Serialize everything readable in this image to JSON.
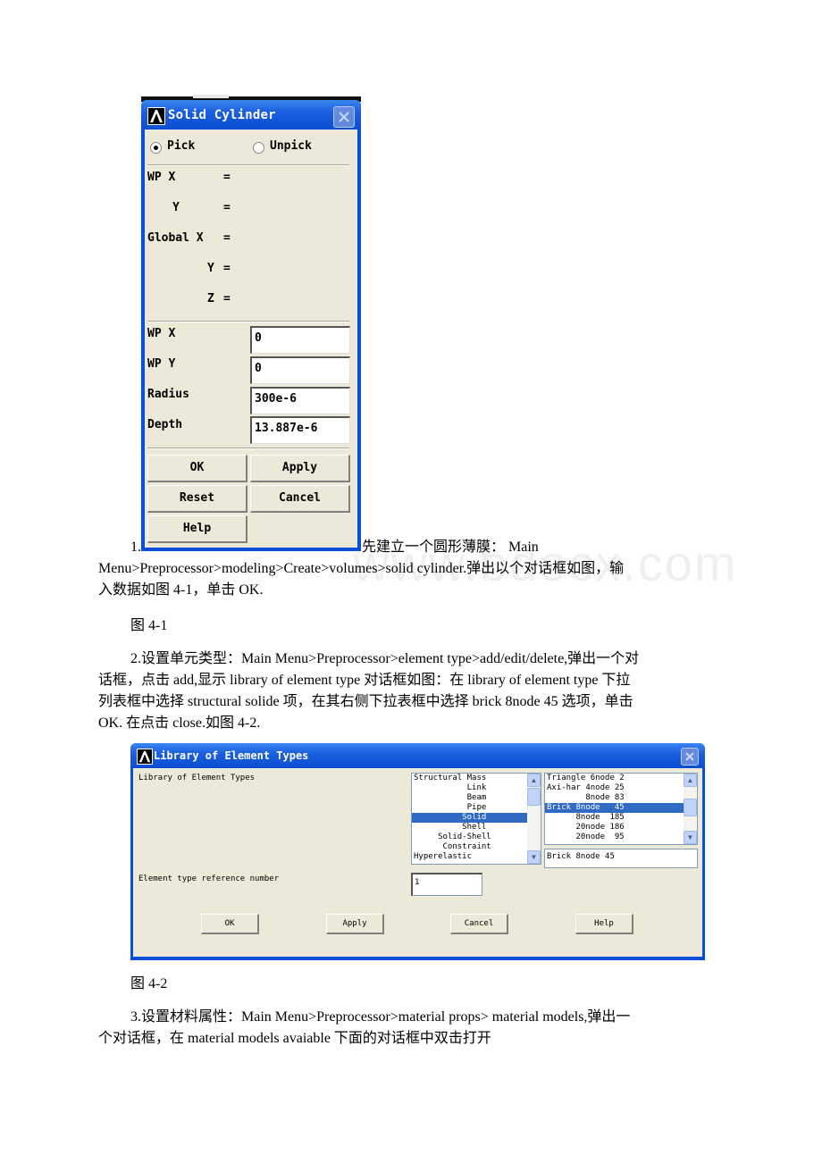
{
  "window1": {
    "title": "Solid Cylinder",
    "radio_pick": "Pick",
    "radio_unpick": "Unpick",
    "selected_radio": "Pick",
    "readouts": [
      {
        "label": "WP X",
        "eq": "="
      },
      {
        "label": "Y",
        "eq": "="
      },
      {
        "label": "Global X",
        "eq": "="
      },
      {
        "label": "Y",
        "eq": "="
      },
      {
        "label": "Z",
        "eq": "="
      }
    ],
    "inputs": [
      {
        "label": "WP X",
        "value": "0"
      },
      {
        "label": "WP Y",
        "value": "0"
      },
      {
        "label": "Radius",
        "value": "300e-6"
      },
      {
        "label": "Depth",
        "value": "13.887e-6"
      }
    ],
    "buttons": {
      "ok": "OK",
      "apply": "Apply",
      "reset": "Reset",
      "cancel": "Cancel",
      "help": "Help"
    }
  },
  "paragraphs": {
    "p1_num": "1.",
    "p1_line1": "先建立一个圆形薄膜： Main",
    "p1_line2": "Menu>Preprocessor>modeling>Create>volumes>solid cylinder.弹出以个对话框如图，输",
    "p1_line3": "入数据如图 4-1，单击 OK.",
    "fig1_caption": "图 4-1",
    "p2_line1": "2.设置单元类型：Main Menu>Preprocessor>element type>add/edit/delete,弹出一个对",
    "p2_line2": "话框，点击 add,显示 library of element type 对话框如图：在 library of element type 下拉",
    "p2_line3": "列表框中选择 structural solide 项，在其右侧下拉表框中选择 brick 8node 45 选项，单击",
    "p2_line4": "OK. 在点击 close.如图 4-2.",
    "fig2_caption": "图 4-2",
    "p3_line1": "3.设置材料属性：Main Menu>Preprocessor>material props> material models,弹出一",
    "p3_line2": "个对话框，在 material models avaiable 下面的对话框中双击打开"
  },
  "window2": {
    "title": "Library of Element Types",
    "library_label": "Library of Element Types",
    "left_list": [
      {
        "text": "Structural Mass",
        "selected": false
      },
      {
        "text": "           Link",
        "selected": false
      },
      {
        "text": "           Beam",
        "selected": false
      },
      {
        "text": "           Pipe",
        "selected": false
      },
      {
        "text": "          Solid",
        "selected": true
      },
      {
        "text": "          Shell",
        "selected": false
      },
      {
        "text": "     Solid-Shell",
        "selected": false
      },
      {
        "text": "      Constraint",
        "selected": false
      },
      {
        "text": "Hyperelastic",
        "selected": false
      }
    ],
    "right_list": [
      {
        "text": "Triangle 6node 2",
        "selected": false
      },
      {
        "text": "Axi-har 4node 25",
        "selected": false
      },
      {
        "text": "        8node 83",
        "selected": false
      },
      {
        "text": "Brick 8node   45",
        "selected": true
      },
      {
        "text": "      8node  185",
        "selected": false
      },
      {
        "text": "      20node 186",
        "selected": false
      },
      {
        "text": "      20node  95",
        "selected": false
      }
    ],
    "selected_value": "Brick 8node   45",
    "ref_label": "Element type reference number",
    "ref_value": "1",
    "buttons": {
      "ok": "OK",
      "apply": "Apply",
      "cancel": "Cancel",
      "help": "Help"
    }
  },
  "watermark": "www.bdocx.com"
}
